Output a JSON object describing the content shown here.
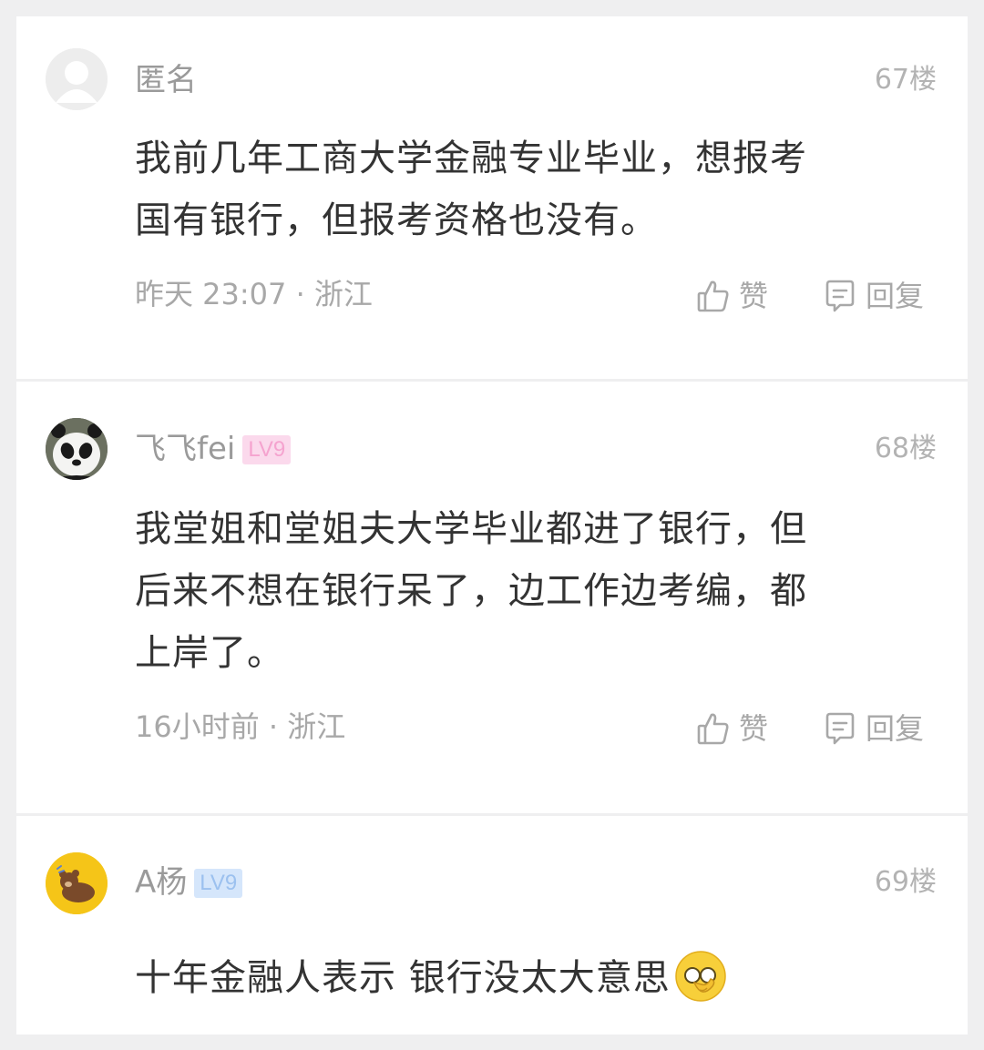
{
  "comments": [
    {
      "name": "匿名",
      "level": "",
      "floor": "67楼",
      "text_lines": [
        "我前几年工商大学金融专业毕业，想报考",
        "国有银行，但报考资格也没有。"
      ],
      "meta": "昨天 23:07 · 浙江",
      "like_label": "赞",
      "reply_label": "回复"
    },
    {
      "name": "飞飞fei",
      "level": "LV9",
      "floor": "68楼",
      "text_lines": [
        "我堂姐和堂姐夫大学毕业都进了银行，但",
        "后来不想在银行呆了，边工作边考编，都",
        "上岸了。"
      ],
      "meta": "16小时前 · 浙江",
      "like_label": "赞",
      "reply_label": "回复"
    },
    {
      "name": "A杨",
      "level": "LV9",
      "floor": "69楼",
      "text_lines": [
        "十年金融人表示 银行没太大意思"
      ],
      "emoji": "facepalm-emoji"
    }
  ],
  "colors": {
    "background": "#efeff0",
    "card": "#ffffff",
    "name": "#9a9a9a",
    "text": "#333333",
    "meta": "#a8a8a8",
    "lv_pink": "#fbd9ec",
    "lv_blue": "#d5e6fb",
    "avatar3_bg": "#f5c518"
  }
}
